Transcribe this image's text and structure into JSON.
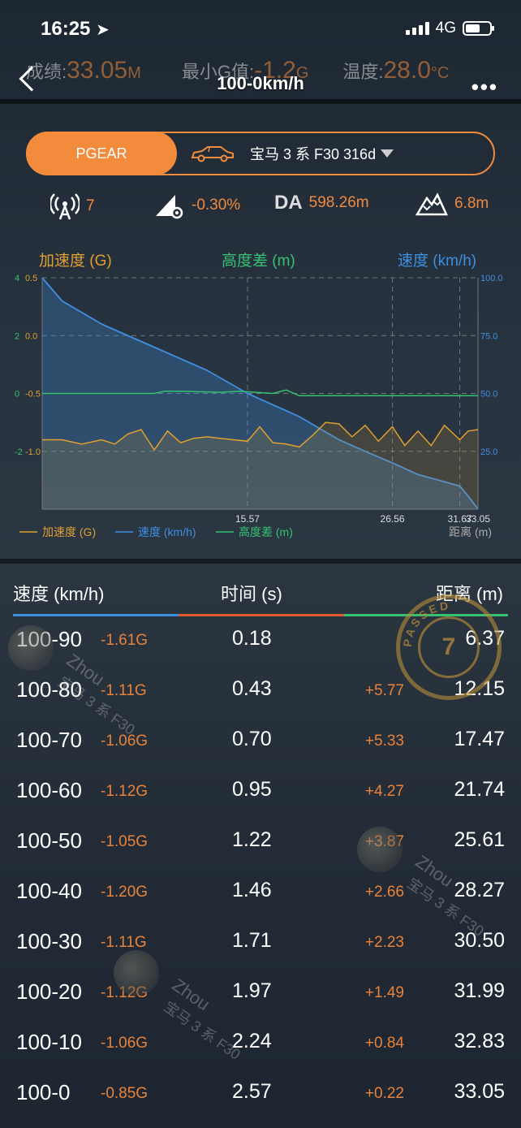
{
  "status": {
    "time": "16:25",
    "network": "4G"
  },
  "header": {
    "score_label": "成绩:",
    "score_value": "33.05",
    "score_unit": "M",
    "min_g_label": "最小G值:",
    "min_g_value": "-1.2",
    "min_g_unit": "G",
    "temp_label": "温度:",
    "temp_value": "28.0",
    "temp_unit": "°C",
    "title": "100-0km/h",
    "more": "•••"
  },
  "selector": {
    "mode": "PGEAR",
    "car": "宝马 3 系 F30 316d"
  },
  "metrics": {
    "satellites": "7",
    "slope": "-0.30%",
    "da_label": "DA",
    "da_value": "598.26m",
    "altitude": "6.8m"
  },
  "colors": {
    "accent": "#f28b3b",
    "speed": "#3f8fe0",
    "altitude": "#35c172",
    "accel": "#e0a030"
  },
  "chart_data": {
    "type": "line",
    "title": "",
    "left_axis_label": "加速度 (G)",
    "mid_axis_label": "高度差 (m)",
    "right_axis_label": "速度 (km/h)",
    "xlabel": "距离 (m)",
    "x_ticks": [
      "15.57",
      "26.56",
      "31.67",
      "33.05"
    ],
    "xlim": [
      0,
      33.05
    ],
    "accel_ticks": [
      "4",
      "2",
      "0",
      "-2"
    ],
    "alt_ticks": [
      "0.5",
      "0.0",
      "-0.5",
      "-1.0"
    ],
    "speed_ticks": [
      "100.0",
      "75.0",
      "50.0",
      "25.0"
    ],
    "accel_ylim": [
      -4,
      4
    ],
    "alt_ylim": [
      -1.5,
      0.5
    ],
    "speed_ylim": [
      0,
      100
    ],
    "series": [
      {
        "name": "加速度 (G)",
        "x": [
          0,
          1.5,
          3.0,
          4.5,
          5.5,
          6.5,
          7.5,
          8.5,
          9.5,
          10.5,
          11.5,
          12.5,
          13.5,
          14.5,
          15.57,
          16.5,
          17.5,
          18.5,
          19.5,
          20.5,
          21.5,
          22.5,
          23.5,
          24.5,
          25.5,
          26.56,
          27.5,
          28.5,
          29.5,
          30.5,
          31.67,
          32.3,
          33.05
        ],
        "values": [
          -1.6,
          -1.6,
          -1.75,
          -1.6,
          -1.75,
          -1.4,
          -1.25,
          -1.95,
          -1.3,
          -1.7,
          -1.55,
          -1.5,
          -1.55,
          -1.6,
          -1.65,
          -1.15,
          -1.7,
          -1.75,
          -1.85,
          -1.45,
          -1.0,
          -1.05,
          -1.5,
          -1.1,
          -1.65,
          -1.15,
          -1.8,
          -1.3,
          -1.8,
          -1.1,
          -1.6,
          -1.3,
          -1.25
        ]
      },
      {
        "name": "速度 (km/h)",
        "x": [
          0,
          1.5,
          4.5,
          8.5,
          12.5,
          15.57,
          19.5,
          22.5,
          24.5,
          26.56,
          28.5,
          31.67,
          32.4,
          33.05
        ],
        "values": [
          100,
          90,
          80,
          70,
          60,
          50,
          40,
          30,
          25,
          20,
          15,
          10,
          5,
          0
        ]
      },
      {
        "name": "高度差 (m)",
        "x": [
          0,
          8.5,
          9.3,
          10.5,
          13.5,
          15.0,
          17.5,
          18.5,
          19.5,
          33.05
        ],
        "values": [
          -0.5,
          -0.5,
          -0.48,
          -0.48,
          -0.49,
          -0.48,
          -0.5,
          -0.47,
          -0.52,
          -0.52
        ]
      }
    ]
  },
  "table": {
    "headers": [
      "速度 (km/h)",
      "时间 (s)",
      "距离 (m)"
    ],
    "rows": [
      {
        "speed": "100-90",
        "g": "-1.61G",
        "time": "0.18",
        "delta": "",
        "dist": "6.37"
      },
      {
        "speed": "100-80",
        "g": "-1.11G",
        "time": "0.43",
        "delta": "+5.77",
        "dist": "12.15"
      },
      {
        "speed": "100-70",
        "g": "-1.06G",
        "time": "0.70",
        "delta": "+5.33",
        "dist": "17.47"
      },
      {
        "speed": "100-60",
        "g": "-1.12G",
        "time": "0.95",
        "delta": "+4.27",
        "dist": "21.74"
      },
      {
        "speed": "100-50",
        "g": "-1.05G",
        "time": "1.22",
        "delta": "+3.87",
        "dist": "25.61"
      },
      {
        "speed": "100-40",
        "g": "-1.20G",
        "time": "1.46",
        "delta": "+2.66",
        "dist": "28.27"
      },
      {
        "speed": "100-30",
        "g": "-1.11G",
        "time": "1.71",
        "delta": "+2.23",
        "dist": "30.50"
      },
      {
        "speed": "100-20",
        "g": "-1.12G",
        "time": "1.97",
        "delta": "+1.49",
        "dist": "31.99"
      },
      {
        "speed": "100-10",
        "g": "-1.06G",
        "time": "2.24",
        "delta": "+0.84",
        "dist": "32.83"
      },
      {
        "speed": "100-0",
        "g": "-0.85G",
        "time": "2.57",
        "delta": "+0.22",
        "dist": "33.05"
      }
    ]
  },
  "stamp": {
    "text": "PASSED",
    "number": "7"
  },
  "watermark": {
    "name": "Zhou",
    "car": "宝马 3 系 F30"
  }
}
